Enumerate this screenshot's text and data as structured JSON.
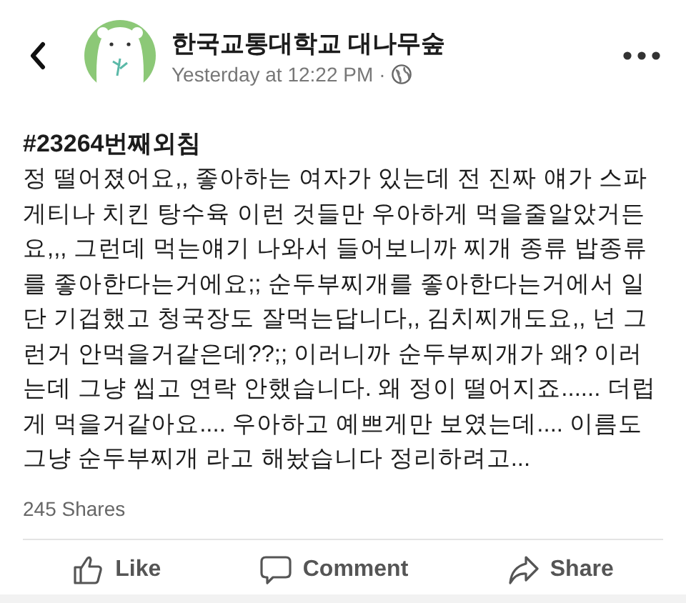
{
  "header": {
    "page_name": "한국교통대학교 대나무숲",
    "timestamp": "Yesterday at 12:22 PM",
    "separator": "·"
  },
  "post": {
    "title": "#23264번째외침",
    "body": "정 떨어졌어요,, 좋아하는 여자가 있는데 전 진짜 얘가 스파게티나 치킨 탕수육 이런 것들만 우아하게 먹을줄알았거든요,,, 그런데 먹는얘기 나와서 들어보니까 찌개 종류 밥종류를 좋아한다는거에요;; 순두부찌개를 좋아한다는거에서 일단 기겁했고 청국장도 잘먹는답니다,, 김치찌개도요,, 넌 그런거 안먹을거같은데??;; 이러니까 순두부찌개가 왜? 이러는데 그냥 씹고 연락 안했습니다. 왜 정이 떨어지죠...... 더럽게 먹을거같아요.... 우아하고 예쁘게만 보였는데.... 이름도 그냥 순두부찌개 라고 해놨습니다 정리하려고..."
  },
  "shares": "245 Shares",
  "actions": [
    {
      "kind": "like",
      "label": "Like"
    },
    {
      "kind": "comment",
      "label": "Comment"
    },
    {
      "kind": "share",
      "label": "Share"
    }
  ]
}
